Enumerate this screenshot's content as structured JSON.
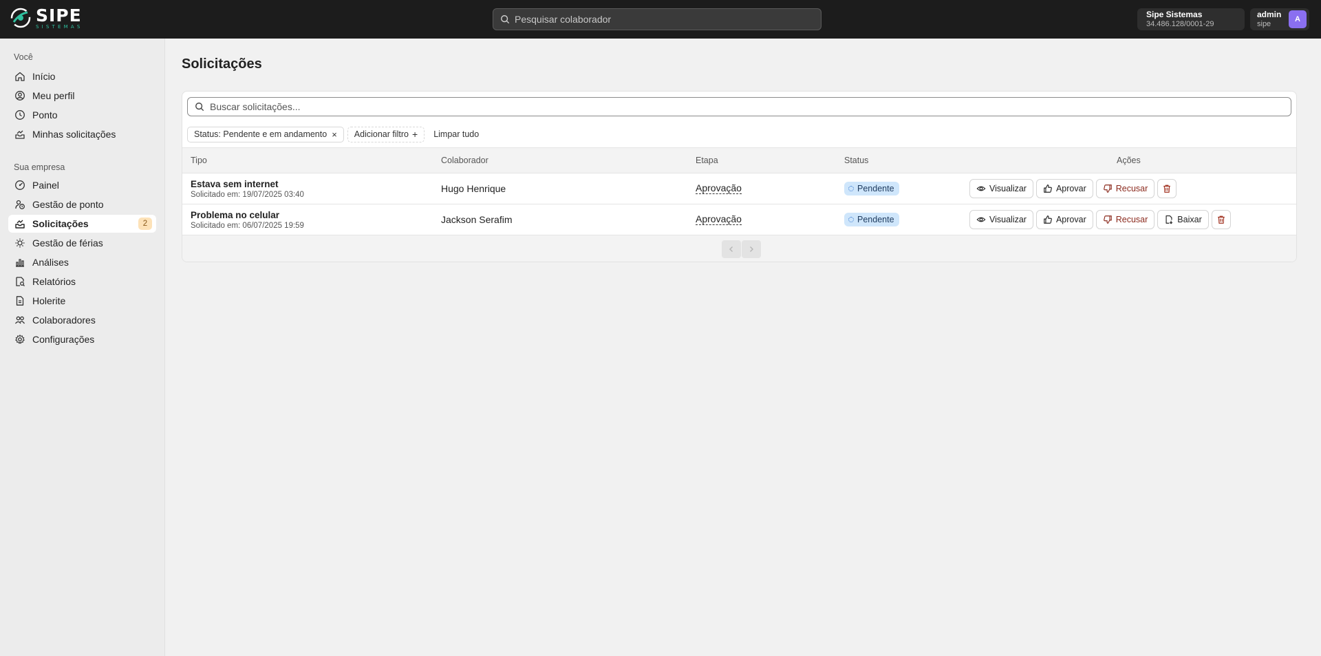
{
  "header": {
    "logo_main": "SIPE",
    "logo_sub": "SISTEMAS",
    "search_placeholder": "Pesquisar colaborador",
    "company_name": "Sipe Sistemas",
    "company_doc": "34.486.128/0001-29",
    "user_name": "admin",
    "user_sub": "sipe",
    "avatar_letter": "A"
  },
  "sidebar": {
    "section_you": "Você",
    "you_items": [
      {
        "label": "Início",
        "icon": "home-icon"
      },
      {
        "label": "Meu perfil",
        "icon": "user-circle-icon"
      },
      {
        "label": "Ponto",
        "icon": "clock-icon"
      },
      {
        "label": "Minhas solicitações",
        "icon": "inbox-icon"
      }
    ],
    "section_company": "Sua empresa",
    "company_items": [
      {
        "label": "Painel",
        "icon": "gauge-icon"
      },
      {
        "label": "Gestão de ponto",
        "icon": "clock-users-icon"
      },
      {
        "label": "Solicitações",
        "icon": "inbox-icon",
        "badge": "2",
        "active": true
      },
      {
        "label": "Gestão de férias",
        "icon": "sun-icon"
      },
      {
        "label": "Análises",
        "icon": "bar-chart-icon"
      },
      {
        "label": "Relatórios",
        "icon": "report-search-icon"
      },
      {
        "label": "Holerite",
        "icon": "file-icon"
      },
      {
        "label": "Colaboradores",
        "icon": "users-icon"
      },
      {
        "label": "Configurações",
        "icon": "gear-icon"
      }
    ]
  },
  "main": {
    "title": "Solicitações",
    "search_placeholder": "Buscar solicitações...",
    "filter_chip": "Status: Pendente e em andamento",
    "add_filter": "Adicionar filtro",
    "clear_all": "Limpar tudo",
    "columns": {
      "type": "Tipo",
      "employee": "Colaborador",
      "stage": "Etapa",
      "status": "Status",
      "actions": "Ações"
    },
    "rows": [
      {
        "type": "Estava sem internet",
        "requested": "Solicitado em: 19/07/2025 03:40",
        "employee": "Hugo Henrique",
        "stage": "Aprovação",
        "status": "Pendente"
      },
      {
        "type": "Problema no celular",
        "requested": "Solicitado em: 06/07/2025 19:59",
        "employee": "Jackson Serafim",
        "stage": "Aprovação",
        "status": "Pendente"
      }
    ],
    "action_labels": {
      "view": "Visualizar",
      "approve": "Aprovar",
      "refuse": "Recusar",
      "download": "Baixar"
    }
  },
  "colors": {
    "topbar": "#1c1c1c",
    "accent_teal": "#2fbf9e",
    "badge_bg": "#fde2b8",
    "status_bg": "#cfe6fb",
    "refuse_text": "#8b2a1d",
    "avatar": "#8a6ff0"
  }
}
